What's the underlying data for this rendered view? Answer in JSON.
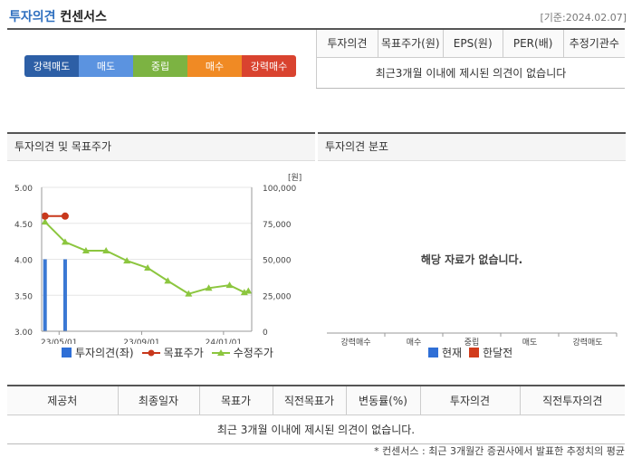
{
  "header": {
    "title_main": "투자의견",
    "title_sub": "컨센서스",
    "as_of": "[기준:2024.02.07]"
  },
  "scale": {
    "items": [
      {
        "label": "강력매도",
        "color": "#2d5fa6"
      },
      {
        "label": "매도",
        "color": "#5b93e0"
      },
      {
        "label": "중립",
        "color": "#7cb342"
      },
      {
        "label": "매수",
        "color": "#f08a24"
      },
      {
        "label": "강력매수",
        "color": "#d9432f"
      }
    ]
  },
  "summary": {
    "columns": [
      "투자의견",
      "목표주가(원)",
      "EPS(원)",
      "PER(배)",
      "추정기관수"
    ],
    "empty_message": "최근3개월 이내에 제시된 의견이 없습니다"
  },
  "panel_left": {
    "title": "투자의견 및 목표주가",
    "legend": {
      "opinion": "투자의견(좌)",
      "target": "목표주가",
      "adjusted": "수정주가"
    }
  },
  "panel_right": {
    "title": "투자의견 분포",
    "empty_message": "해당 자료가 없습니다.",
    "categories": [
      "강력매수",
      "매수",
      "중립",
      "매도",
      "강력매도"
    ],
    "legend": {
      "current": "현재",
      "previous": "한달전"
    },
    "colors": {
      "current": "#2f6fd6",
      "previous": "#d23c1c"
    }
  },
  "chart_data": {
    "type": "line",
    "left_axis": {
      "ticks": [
        "5.00",
        "4.50",
        "4.00",
        "3.50",
        "3.00"
      ],
      "range": [
        3.0,
        5.0
      ]
    },
    "right_axis": {
      "unit": "[원]",
      "ticks": [
        "100,000",
        "75,000",
        "50,000",
        "25,000",
        "0"
      ],
      "range": [
        0,
        100000
      ]
    },
    "x_tick_labels": [
      "23/05/01",
      "23/09/01",
      "24/01/01"
    ],
    "series": [
      {
        "name": "수정주가",
        "color": "#8cc63f",
        "points": [
          [
            "2023-04-10",
            76000
          ],
          [
            "2023-05-10",
            62000
          ],
          [
            "2023-06-10",
            56000
          ],
          [
            "2023-07-10",
            56000
          ],
          [
            "2023-08-10",
            49000
          ],
          [
            "2023-09-10",
            44000
          ],
          [
            "2023-10-10",
            35000
          ],
          [
            "2023-11-10",
            26000
          ],
          [
            "2023-12-10",
            30000
          ],
          [
            "2024-01-10",
            32000
          ],
          [
            "2024-02-01",
            27000
          ],
          [
            "2024-02-07",
            28000
          ]
        ]
      },
      {
        "name": "목표주가",
        "color": "#c8381c",
        "points": [
          [
            "2023-04-10",
            80000
          ],
          [
            "2023-05-10",
            80000
          ]
        ]
      }
    ],
    "opinion_bars": {
      "name": "투자의견(좌)",
      "color": "#3a78d4",
      "points": [
        [
          "2023-04-10",
          4.0
        ],
        [
          "2023-05-10",
          4.0
        ]
      ]
    }
  },
  "bottom_table": {
    "columns": [
      "제공처",
      "최종일자",
      "목표가",
      "직전목표가",
      "변동률(%)",
      "투자의견",
      "직전투자의견"
    ],
    "empty_message": "최근 3개월 이내에 제시된 의견이 없습니다."
  },
  "footnote": "* 컨센서스 : 최근 3개월간 증권사에서 발표한 추정치의 평균"
}
